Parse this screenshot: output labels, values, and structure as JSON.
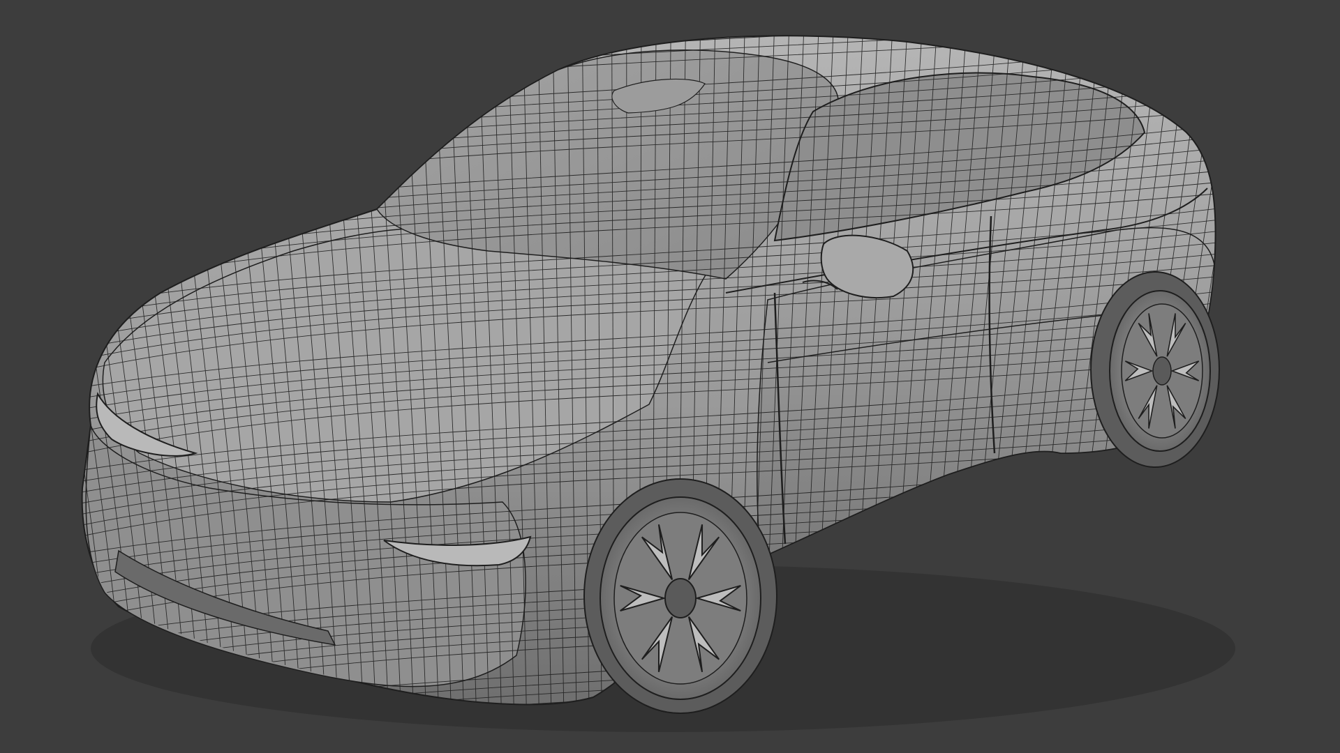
{
  "viewport": {
    "background_color": "#3d3d3d",
    "model_surface_color": "#9a9a9a",
    "model_shadow_color": "#6e6e6e",
    "wireframe_color": "#1e1e1e",
    "highlight_color": "#c4c4c4"
  },
  "model": {
    "icon": "car-wireframe-mesh",
    "display_mode": "solid-with-wireframe"
  }
}
